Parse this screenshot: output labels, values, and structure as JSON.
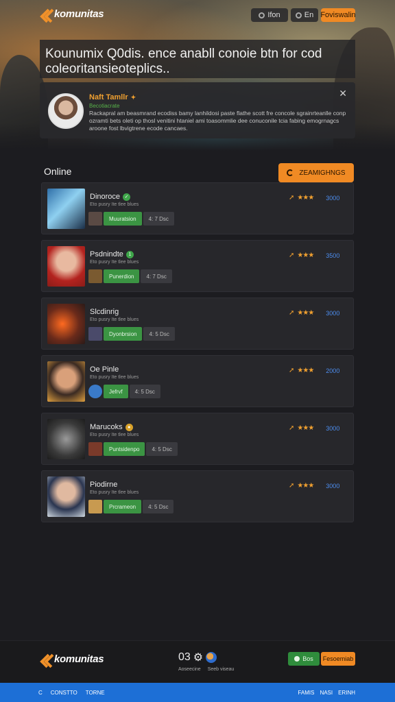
{
  "nav": {
    "logo_text": "komunitas",
    "login_label": "Ifon",
    "signup_label": "En",
    "cta_label": "Foviswalin"
  },
  "announcement": {
    "headline": "Kounumix Q0dis. ence anabll conoie btn for cod coleoritansieoteplics..",
    "profile_name": "Naft Tamllr",
    "profile_role": "Becotiacrate",
    "profile_desc": "Rackapral am beasmrand ecodiss bamy lanhildosi paste flathe scott fre concole sgrainrteanlle conp ozramti bets oleti op thosl venitini htaniel ami toasommlie dee conuconile tcia fabing emogrnagcs aroone fost lbvigtrene ecode cancaes."
  },
  "online": {
    "title": "Online",
    "new_button": "ZEAMIGHNGS"
  },
  "rows": [
    {
      "name": "Dinoroce",
      "sub": "Eto pusry Ite tlee blues",
      "tag": "Muuratsion",
      "count": "4: 7 Dsc",
      "score": "3000",
      "badge": "green"
    },
    {
      "name": "Psdnindte",
      "sub": "Eto pusry Ite tlee blues",
      "tag": "Punerdion",
      "count": "4: 7 Dsc",
      "score": "3500",
      "badge": "green"
    },
    {
      "name": "Slcdinrig",
      "sub": "Eto pusry Ite tlee blues",
      "tag": "Dyonbrsion",
      "count": "4: 5 Dsc",
      "score": "3000",
      "badge": ""
    },
    {
      "name": "Oe Pinle",
      "sub": "Eto pusry Ite tlee blues",
      "tag": "Jefrvf",
      "count": "4: 5 Dsc",
      "score": "2000",
      "badge": ""
    },
    {
      "name": "Marucoks",
      "sub": "Eto pusry Ite tlee blues",
      "tag": "Puntsidenpo",
      "count": "4: 5 Dsc",
      "score": "3000",
      "badge": "gold"
    },
    {
      "name": "Piodirne",
      "sub": "Eto pusry Ite tlee blues",
      "tag": "Prcrameon",
      "count": "4: 5 Dsc",
      "score": "3000",
      "badge": ""
    }
  ],
  "footer": {
    "logo_text": "komunitas",
    "icons_text": "03",
    "label_a": "Aoseecine",
    "label_b": "Seeb viseau",
    "btn_green": "Bos",
    "btn_orange": "Fesoemiab"
  },
  "bottom_bar": {
    "c_label": "C",
    "left_a": "CONSTTO",
    "left_b": "TORNE",
    "right_a": "FAMIS",
    "right_b": "NASI",
    "right_c": "ERINH"
  },
  "colors": {
    "accent_orange": "#f08a24",
    "accent_green": "#3b9443",
    "accent_blue": "#1d6fd6",
    "score_blue": "#4d8ef0"
  }
}
